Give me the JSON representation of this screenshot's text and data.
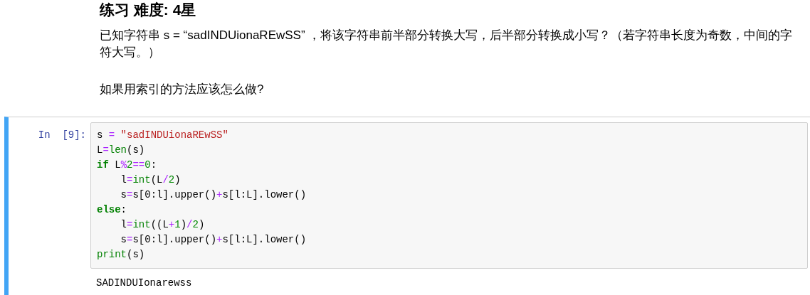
{
  "markdown": {
    "heading": "练习 难度: 4星",
    "paragraphs": [
      "已知字符串 s = “sadINDUionaREwSS” ，将该字符串前半部分转换大写，后半部分转换成小写？（若字符串长度为奇数，中间的字符大写。）",
      "如果用索引的方法应该怎么做?"
    ]
  },
  "cell": {
    "selected": true,
    "prompt": "In  [9]:",
    "code": [
      [
        {
          "t": "s ",
          "kind": "plain"
        },
        {
          "t": "=",
          "kind": "op"
        },
        {
          "t": " \"sadINDUionaREwSS\"",
          "kind": "str"
        }
      ],
      [
        {
          "t": "L",
          "kind": "plain"
        },
        {
          "t": "=",
          "kind": "op"
        },
        {
          "t": "len",
          "kind": "builtin"
        },
        {
          "t": "(s)",
          "kind": "plain"
        }
      ],
      [
        {
          "t": "if",
          "kind": "kw"
        },
        {
          "t": " L",
          "kind": "plain"
        },
        {
          "t": "%",
          "kind": "op"
        },
        {
          "t": "2",
          "kind": "num"
        },
        {
          "t": "==",
          "kind": "op"
        },
        {
          "t": "0",
          "kind": "num"
        },
        {
          "t": ":",
          "kind": "plain"
        }
      ],
      [
        {
          "t": "    l",
          "kind": "plain"
        },
        {
          "t": "=",
          "kind": "op"
        },
        {
          "t": "int",
          "kind": "builtin"
        },
        {
          "t": "(L",
          "kind": "plain"
        },
        {
          "t": "/",
          "kind": "op"
        },
        {
          "t": "2",
          "kind": "num"
        },
        {
          "t": ")",
          "kind": "plain"
        }
      ],
      [
        {
          "t": "    s",
          "kind": "plain"
        },
        {
          "t": "=",
          "kind": "op"
        },
        {
          "t": "s[0:l].upper()",
          "kind": "plain"
        },
        {
          "t": "+",
          "kind": "op"
        },
        {
          "t": "s[l:L].lower()",
          "kind": "plain"
        }
      ],
      [
        {
          "t": "else",
          "kind": "kw"
        },
        {
          "t": ":",
          "kind": "plain"
        }
      ],
      [
        {
          "t": "    l",
          "kind": "plain"
        },
        {
          "t": "=",
          "kind": "op"
        },
        {
          "t": "int",
          "kind": "builtin"
        },
        {
          "t": "((L",
          "kind": "plain"
        },
        {
          "t": "+",
          "kind": "op"
        },
        {
          "t": "1",
          "kind": "num"
        },
        {
          "t": ")",
          "kind": "plain"
        },
        {
          "t": "/",
          "kind": "op"
        },
        {
          "t": "2",
          "kind": "num"
        },
        {
          "t": ")",
          "kind": "plain"
        }
      ],
      [
        {
          "t": "    s",
          "kind": "plain"
        },
        {
          "t": "=",
          "kind": "op"
        },
        {
          "t": "s[0:l].upper()",
          "kind": "plain"
        },
        {
          "t": "+",
          "kind": "op"
        },
        {
          "t": "s[l:L].lower()",
          "kind": "plain"
        }
      ],
      [
        {
          "t": "print",
          "kind": "builtin"
        },
        {
          "t": "(s)",
          "kind": "plain"
        }
      ]
    ],
    "output": "SADINDUIonarewss"
  }
}
